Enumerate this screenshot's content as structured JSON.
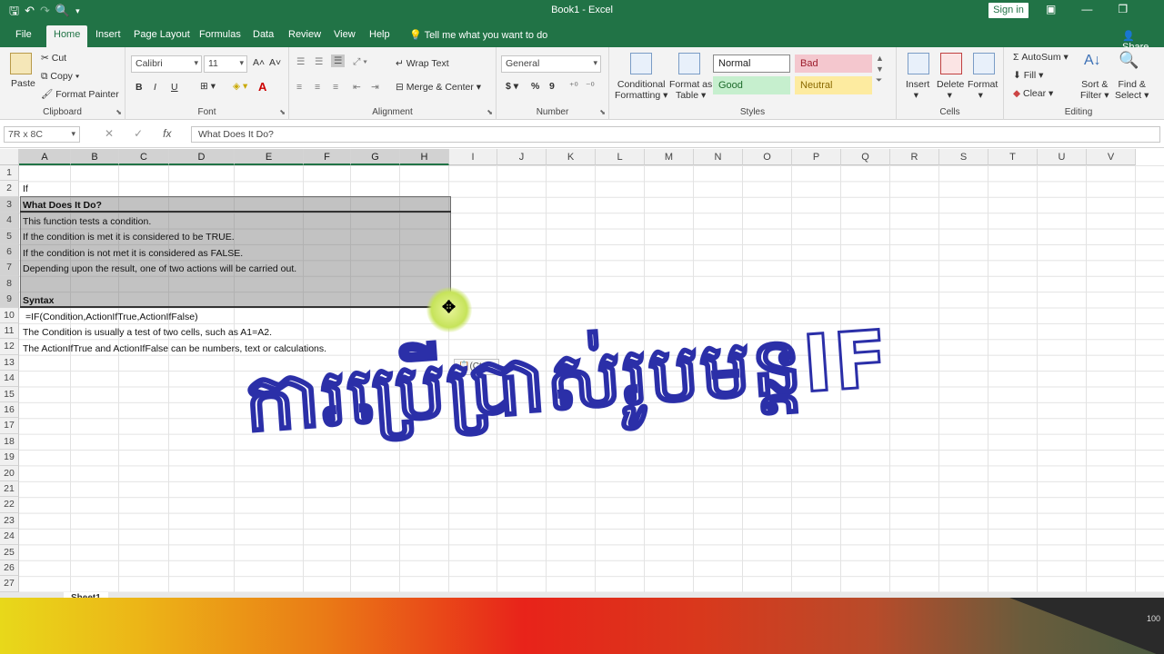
{
  "window": {
    "title": "Book1 - Excel",
    "sign_in": "Sign in",
    "share": "Share",
    "tell_me": "Tell me what you want to do"
  },
  "tabs": [
    "File",
    "Home",
    "Insert",
    "Page Layout",
    "Formulas",
    "Data",
    "Review",
    "View",
    "Help"
  ],
  "ribbon": {
    "clipboard": {
      "label": "Clipboard",
      "paste": "Paste",
      "cut": "Cut",
      "copy": "Copy",
      "format_painter": "Format Painter"
    },
    "font": {
      "label": "Font",
      "name": "Calibri",
      "size": "11",
      "bold": "B",
      "italic": "I",
      "underline": "U"
    },
    "alignment": {
      "label": "Alignment",
      "wrap": "Wrap Text",
      "merge": "Merge & Center"
    },
    "number": {
      "label": "Number",
      "format": "General",
      "currency": "$",
      "percent": "%",
      "comma": "9"
    },
    "styles": {
      "label": "Styles",
      "conditional_1": "Conditional",
      "conditional_2": "Formatting",
      "format_as_1": "Format as",
      "format_as_2": "Table",
      "normal": "Normal",
      "bad": "Bad",
      "good": "Good",
      "neutral": "Neutral"
    },
    "cells": {
      "label": "Cells",
      "insert": "Insert",
      "delete": "Delete",
      "format": "Format"
    },
    "editing": {
      "label": "Editing",
      "autosum": "AutoSum",
      "fill": "Fill",
      "clear": "Clear",
      "sort_1": "Sort &",
      "sort_2": "Filter",
      "find_1": "Find &",
      "find_2": "Select"
    }
  },
  "formula_bar": {
    "name_box": "7R x 8C",
    "fx": "fx",
    "content": "What Does It Do?"
  },
  "columns": [
    "A",
    "B",
    "C",
    "D",
    "E",
    "F",
    "G",
    "H",
    "I",
    "J",
    "K",
    "L",
    "M",
    "N",
    "O",
    "P",
    "Q",
    "R",
    "S",
    "T",
    "U",
    "V"
  ],
  "rows": [
    "1",
    "2",
    "3",
    "4",
    "5",
    "6",
    "7",
    "8",
    "9",
    "10",
    "11",
    "12",
    "13",
    "14",
    "15",
    "16",
    "17",
    "18",
    "19",
    "20",
    "21",
    "22",
    "23",
    "24",
    "25",
    "26",
    "27"
  ],
  "cells": {
    "r2": "If",
    "r3": "What Does It Do?",
    "r4": "This function tests a condition.",
    "r5": "If the condition is met it is considered to be TRUE.",
    "r6": "If the condition is not met it is considered as FALSE.",
    "r7": "Depending upon the result, one of two actions will be carried out.",
    "r9": "Syntax",
    "r10": "=IF(Condition,ActionIfTrue,ActionIfFalse)",
    "r11": "The Condition is usually a test of two cells, such as A1=A2.",
    "r12": "The ActionIfTrue and ActionIfFalse can be numbers, text or calculations."
  },
  "paste_options": "(Ctrl) ▾",
  "overlay_title": "ការប្រើប្រាស់រូបមន្តIF",
  "sheet_tab": "Sheet1",
  "zoom": "100",
  "colors": {
    "excel_green": "#217346",
    "overlay_stroke": "#2b2fa8"
  }
}
